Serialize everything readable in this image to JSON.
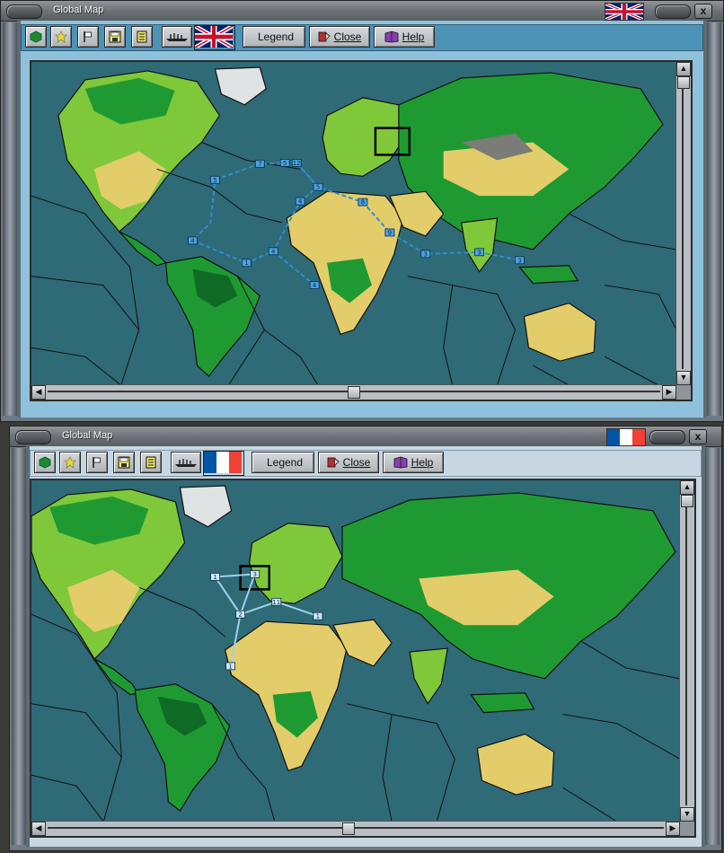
{
  "windows": [
    {
      "title": "Global Map",
      "flag": "uk",
      "legend_label": "Legend",
      "close_label": "Close",
      "help_label": "Help",
      "close_x": "x",
      "route_waypoints": [
        "5",
        "7",
        "12",
        "5",
        "4",
        "8",
        "4",
        "4",
        "1",
        "4",
        "9",
        "3",
        "3",
        "3",
        "5"
      ]
    },
    {
      "title": "Global Map",
      "flag": "fr",
      "legend_label": "Legend",
      "close_label": "Close",
      "help_label": "Help",
      "close_x": "x",
      "route_waypoints": [
        "1",
        "3",
        "2",
        "11",
        "1",
        "1"
      ]
    }
  ],
  "icons": [
    "hexagon-green-icon",
    "star-icon",
    "flag-icon",
    "save-icon",
    "list-icon",
    "ship-icon",
    "close-book-icon",
    "help-book-icon"
  ],
  "colors": {
    "ocean": "#2f6a77",
    "land_desert": "#e2cd6a",
    "land_forest": "#1f9a32",
    "land_grass": "#7fc83a",
    "land_mountain": "#7b7b78",
    "ice": "#dfe3e3",
    "route_uk": "#2f8ed0",
    "route_fr": "#9fd0ef",
    "toolbar_bg": "#4d93b8"
  }
}
